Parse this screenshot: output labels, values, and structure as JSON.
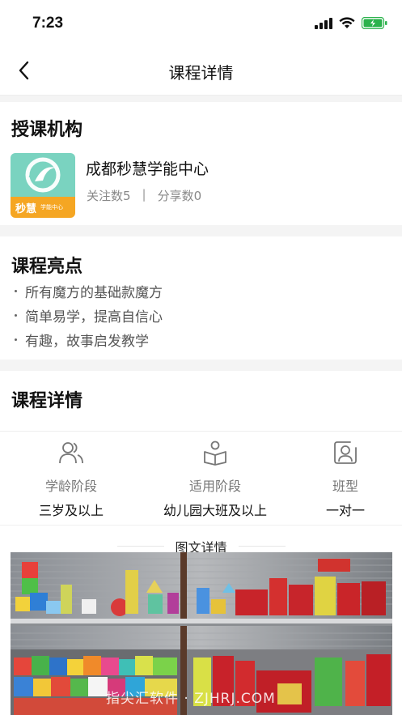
{
  "status_bar": {
    "time": "7:23"
  },
  "nav": {
    "title": "课程详情"
  },
  "org": {
    "section_title": "授课机构",
    "name": "成都秒慧学能中心",
    "followers": "关注数5",
    "shares": "分享数0",
    "logo_text_main": "秒慧",
    "logo_text_sub": "学能中心",
    "logo_colors": {
      "top": "#7ad3c0",
      "bottom": "#f5a623"
    }
  },
  "highlights": {
    "section_title": "课程亮点",
    "items": [
      "所有魔方的基础款魔方",
      "简单易学，提高自信心",
      "有趣，故事启发教学"
    ]
  },
  "details": {
    "section_title": "课程详情",
    "columns": [
      {
        "icon": "users-icon",
        "label": "学龄阶段",
        "value": "三岁及以上"
      },
      {
        "icon": "book-reader-icon",
        "label": "适用阶段",
        "value": "幼儿园大班及以上"
      },
      {
        "icon": "person-card-icon",
        "label": "班型",
        "value": "一对一"
      }
    ],
    "rich_title": "图文详情"
  },
  "photo": {
    "watermark": "指尖汇软件 · ZJHRJ.COM"
  }
}
